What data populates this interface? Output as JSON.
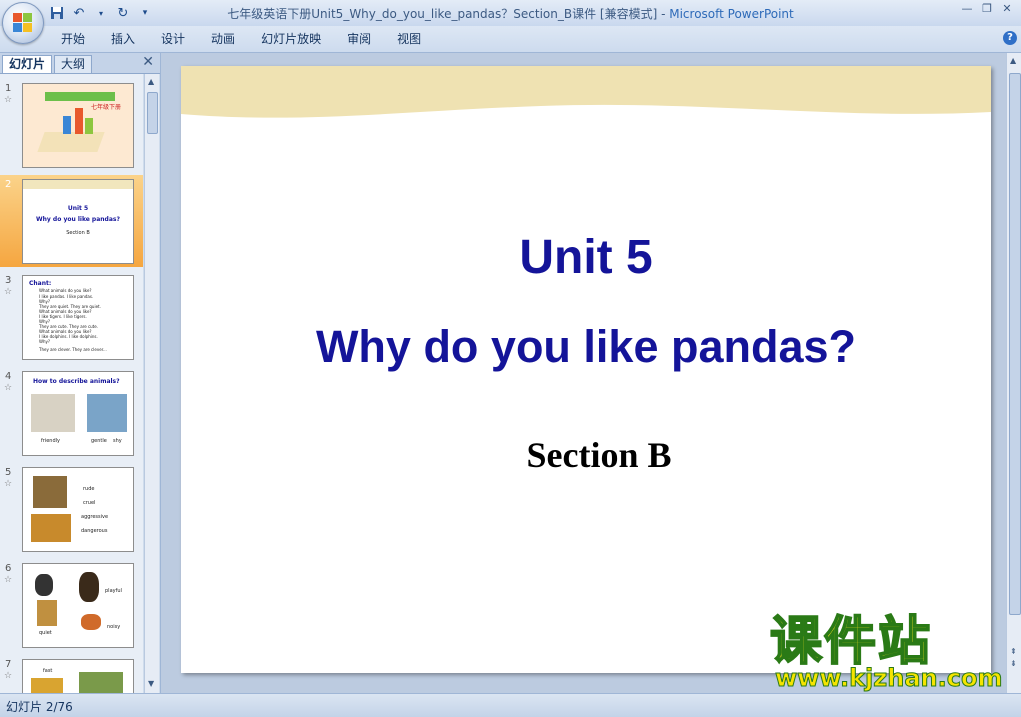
{
  "window": {
    "title": "七年级英语下册Unit5_Why_do_you_like_pandas？Section_B课件 [兼容模式]",
    "separator": " - ",
    "app_name": "Microsoft PowerPoint"
  },
  "quick_access": [
    "save-icon",
    "undo-icon",
    "redo-icon",
    "customize-icon"
  ],
  "ribbon": {
    "tabs": [
      "开始",
      "插入",
      "设计",
      "动画",
      "幻灯片放映",
      "审阅",
      "视图"
    ]
  },
  "panel": {
    "tab_slides": "幻灯片",
    "tab_outline": "大纲"
  },
  "thumbnails": [
    {
      "num": "1",
      "texts": [
        "七年级下册"
      ]
    },
    {
      "num": "2",
      "texts": [
        "Unit 5",
        "Why do you like pandas?",
        "Section B"
      ]
    },
    {
      "num": "3",
      "texts": [
        "Chant:",
        "What animals do you like?",
        "I like pandas. I like pandas.",
        "Why?",
        "They are quiet. They are quiet.",
        "What animals do you like?",
        "I like tigers. I like tigers.",
        "Why?",
        "They are cute. They are cute.",
        "What animals do you like?",
        "I like dolphins. I like dolphins.",
        "Why?",
        "They are clever. They are clever..."
      ]
    },
    {
      "num": "4",
      "texts": [
        "How to describe animals?",
        "friendly",
        "gentle",
        "shy"
      ]
    },
    {
      "num": "5",
      "texts": [
        "rude",
        "cruel",
        "aggressive",
        "dangerous"
      ]
    },
    {
      "num": "6",
      "texts": [
        "playful",
        "quiet",
        "noisy"
      ]
    },
    {
      "num": "7",
      "texts": [
        "fast"
      ]
    }
  ],
  "slide": {
    "title": "Unit 5",
    "subtitle": "Why do you like pandas?",
    "section": "Section B"
  },
  "status": {
    "slide_indicator": "幻灯片 2/76"
  },
  "watermark": {
    "text_cn": "课件站",
    "url": "www.kjzhan.com"
  }
}
